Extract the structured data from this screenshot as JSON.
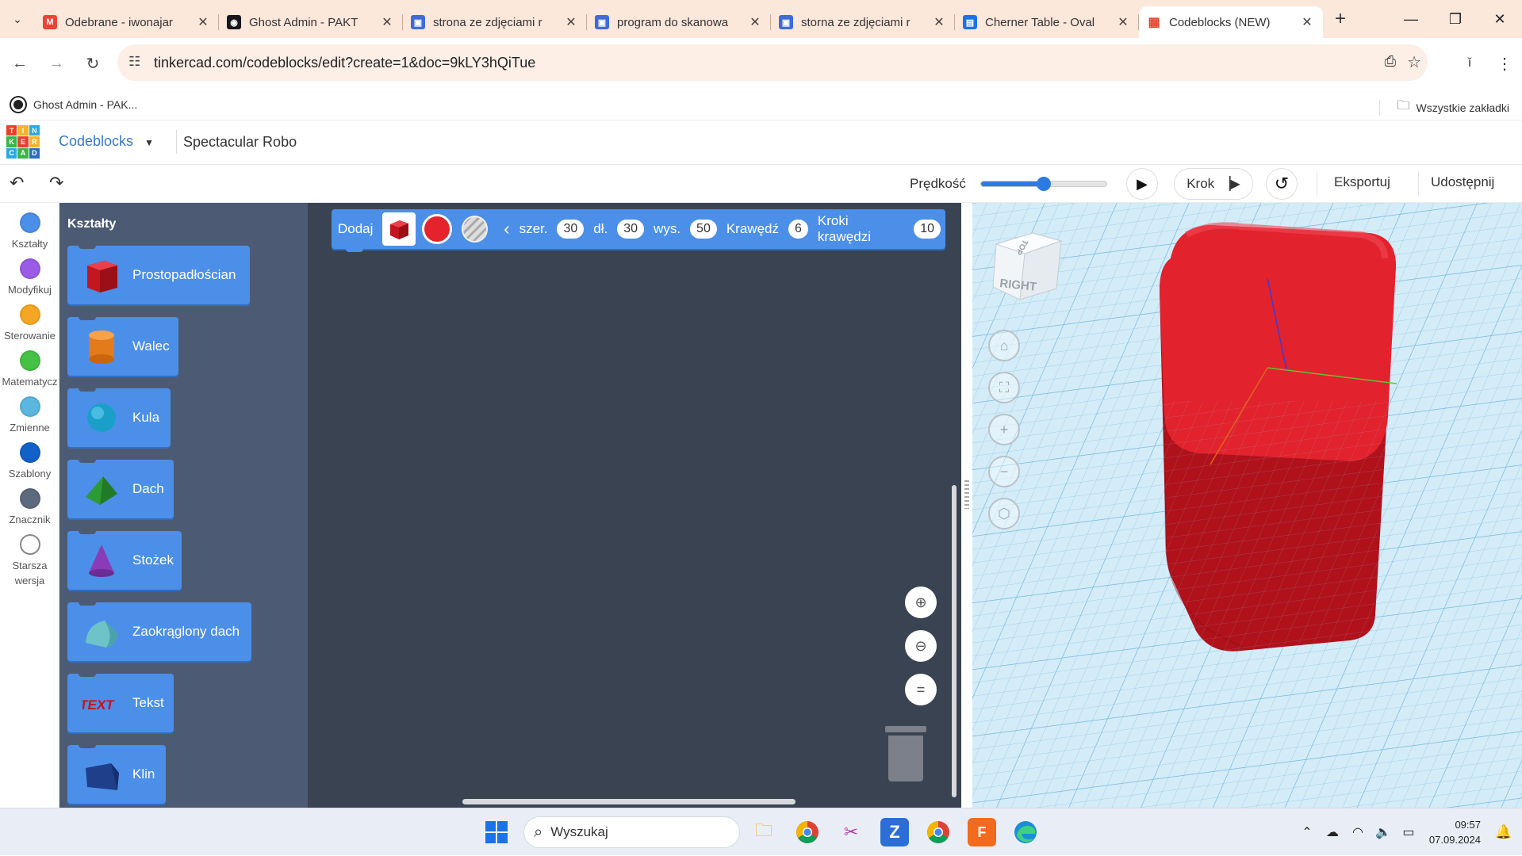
{
  "browser": {
    "tabs": [
      {
        "title": "Odebrane - iwonajar",
        "icon": "gmail-icon",
        "color": "#ea4335",
        "glyph": "M"
      },
      {
        "title": "Ghost Admin - PAKT",
        "icon": "ghost-icon",
        "color": "#15171a",
        "glyph": "◉"
      },
      {
        "title": "strona ze zdjęciami r",
        "icon": "sites-icon",
        "color": "#3f6ad8",
        "glyph": "▣"
      },
      {
        "title": "program do skanowa",
        "icon": "sites-icon",
        "color": "#3f6ad8",
        "glyph": "▣"
      },
      {
        "title": "storna ze zdjęciami r",
        "icon": "sites-icon",
        "color": "#3f6ad8",
        "glyph": "▣"
      },
      {
        "title": "Cherner Table - Oval",
        "icon": "page-icon",
        "color": "#1a73e8",
        "glyph": "▤"
      },
      {
        "title": "Codeblocks (NEW)",
        "icon": "tinkercad-icon",
        "color": "#ffffff",
        "glyph": "▦"
      }
    ],
    "url": "tinkercad.com/codeblocks/edit?create=1&doc=9kLY3hQiTue",
    "bookmarks": [
      {
        "title": "Ghost Admin - PAK..."
      }
    ],
    "all_bookmarks": "Wszystkie zakładki"
  },
  "app": {
    "logo_letters": [
      "T",
      "I",
      "N",
      "K",
      "E",
      "R",
      "C",
      "A",
      "D"
    ],
    "logo_colors": [
      "#e8412b",
      "#f2b52b",
      "#2aa9e0",
      "#3bb54a",
      "#e8412b",
      "#f2b52b",
      "#2aa9e0",
      "#3bb54a",
      "#2a6ebb"
    ],
    "menu": "Codeblocks",
    "project_name": "Spectacular Robo",
    "speed_label": "Prędkość",
    "speed_level": 0.5,
    "step_label": "Krok",
    "export_label": "Eksportuj",
    "share_label": "Udostępnij"
  },
  "categories": [
    {
      "label": "Kształty",
      "color": "#4c8fe8"
    },
    {
      "label": "Modyfikuj",
      "color": "#9a5ce6"
    },
    {
      "label": "Sterowanie",
      "color": "#f5a623"
    },
    {
      "label": "Matematycz",
      "color": "#45c145"
    },
    {
      "label": "Zmienne",
      "color": "#5bb7e0"
    },
    {
      "label": "Szablony",
      "color": "#1261c9"
    },
    {
      "label": "Znacznik",
      "color": "#5d6a7e"
    },
    {
      "label": "Starsza wersja",
      "color": "#ffffff"
    }
  ],
  "palette": {
    "title": "Kształty",
    "shapes": [
      {
        "label": "Prostopadłościan",
        "icon": "box-icon"
      },
      {
        "label": "Walec",
        "icon": "cylinder-icon"
      },
      {
        "label": "Kula",
        "icon": "sphere-icon"
      },
      {
        "label": "Dach",
        "icon": "roof-icon"
      },
      {
        "label": "Stożek",
        "icon": "cone-icon"
      },
      {
        "label": "Zaokrąglony dach",
        "icon": "rounded-roof-icon"
      },
      {
        "label": "Tekst",
        "icon": "text-shape-icon"
      },
      {
        "label": "Klin",
        "icon": "wedge-icon"
      }
    ]
  },
  "block": {
    "add": "Dodaj",
    "color": "#e5232c",
    "width_label": "szer.",
    "width": "30",
    "length_label": "dł.",
    "length": "30",
    "height_label": "wys.",
    "height": "50",
    "edge_label": "Krawędź",
    "edge": "6",
    "edge_steps_label": "Kroki krawędzi",
    "edge_steps": "10"
  },
  "viewport": {
    "viewcube_label": "RIGHT",
    "viewcube_top": "TOP",
    "shape_color": "#d81f2a"
  },
  "taskbar": {
    "search_placeholder": "Wyszukaj",
    "time": "09:57",
    "date": "07.09.2024"
  }
}
